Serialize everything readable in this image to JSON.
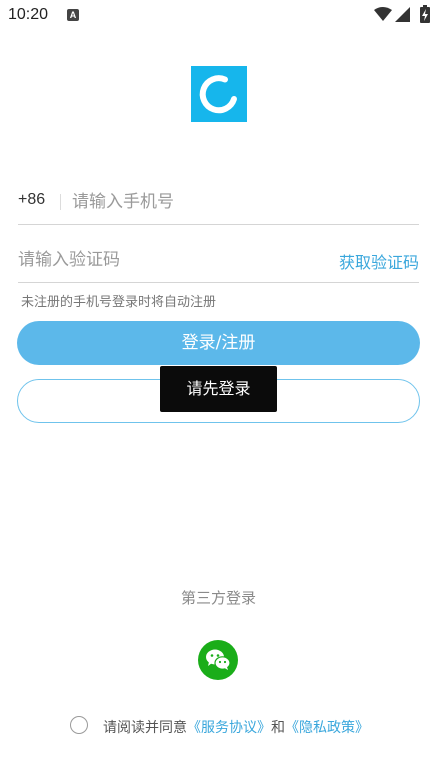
{
  "status_bar": {
    "time": "10:20",
    "notification_letter": "A"
  },
  "login": {
    "country_code": "+86",
    "phone_placeholder": "请输入手机号",
    "code_placeholder": "请输入验证码",
    "get_code_label": "获取验证码",
    "hint": "未注册的手机号登录时将自动注册",
    "login_button_label": "登录/注册",
    "secondary_button_label": ""
  },
  "toast": {
    "message": "请先登录"
  },
  "third_party": {
    "title": "第三方登录"
  },
  "agreement": {
    "prefix": "请阅读并同意",
    "service_link": "《服务协议》",
    "and": "和",
    "privacy_link": "《隐私政策》"
  },
  "colors": {
    "logo": "#16b6ec",
    "login_button": "#5cb8ea",
    "link": "#3aa7dc",
    "wechat": "#1aad19",
    "toast_bg": "#0b0b0b"
  }
}
